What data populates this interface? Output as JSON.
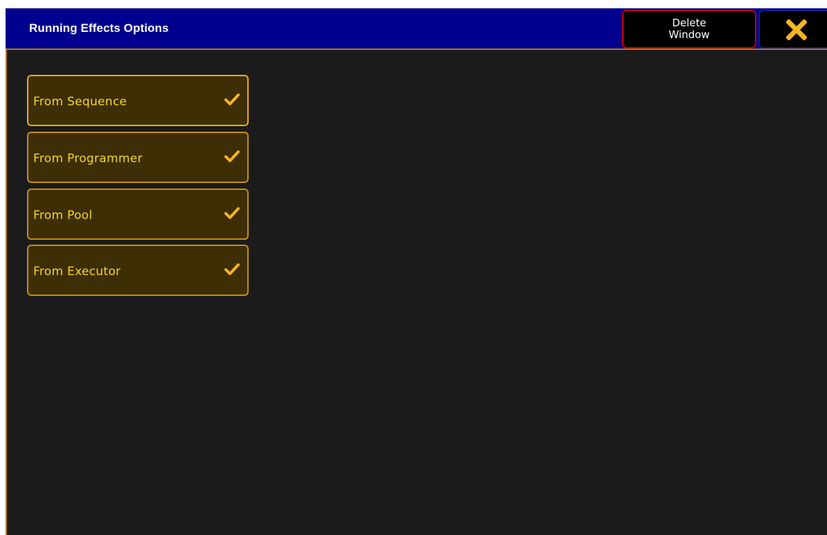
{
  "window": {
    "title": "Running Effects  Options",
    "delete_line1": "Delete",
    "delete_line2": "Window",
    "close_icon": "close-x-icon"
  },
  "colors": {
    "titlebar": "#00008e",
    "background": "#1b1b1b",
    "option_fill": "#3e2e06",
    "option_border": "#c8900a",
    "option_text": "#f2d91e",
    "check": "#f5b423",
    "close_x": "#f5b423",
    "delete_border": "#c00000"
  },
  "options": [
    {
      "label": "From Sequence",
      "checked": true
    },
    {
      "label": "From Programmer",
      "checked": true
    },
    {
      "label": "From Pool",
      "checked": true
    },
    {
      "label": "From Executor",
      "checked": true
    }
  ]
}
